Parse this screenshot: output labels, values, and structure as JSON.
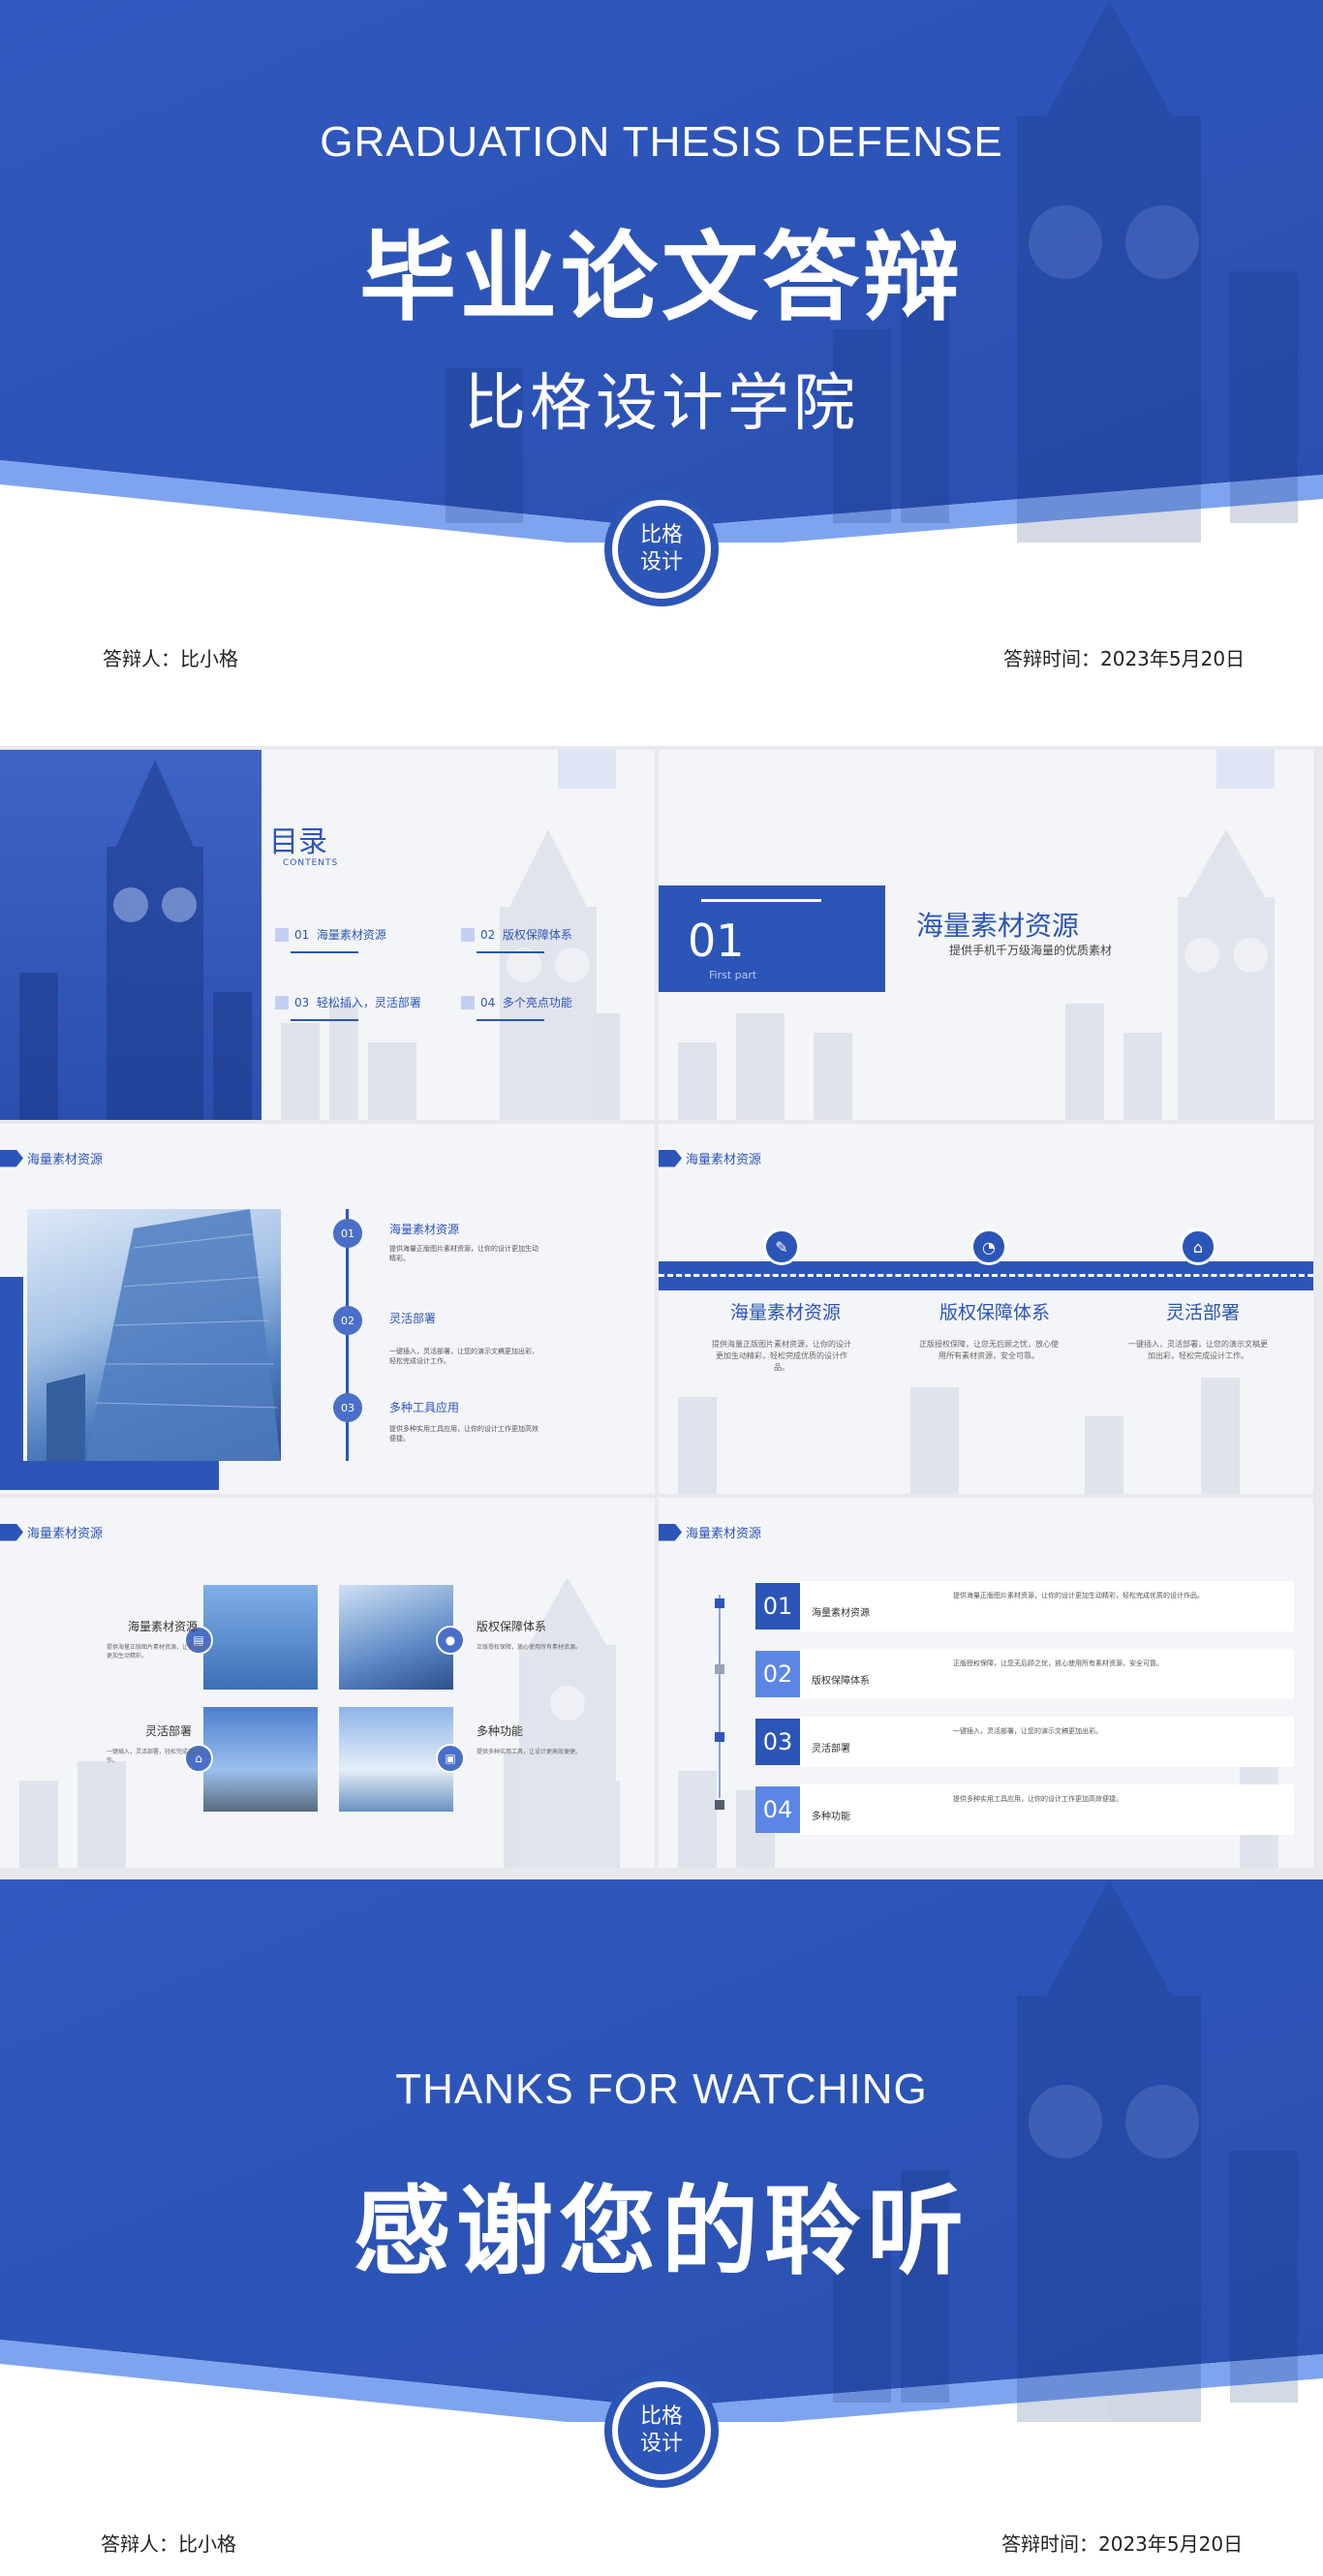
{
  "colors": {
    "brand_blue": "#2c55b8",
    "light_blue": "#4a6fc8",
    "sky_blue": "#7fa4ef",
    "page_bg": "#e7e9ee"
  },
  "cover": {
    "title_en": "GRADUATION THESIS DEFENSE",
    "title_cn": "毕业论文答辩",
    "school": "比格设计学院",
    "seal_line1": "比格",
    "seal_line2": "设计",
    "respondent": "答辩人：比小格",
    "date": "答辩时间：2023年5月20日"
  },
  "toc": {
    "title": "目录",
    "subtitle": "CONTENTS",
    "items": [
      {
        "num": "01",
        "label": "海量素材资源"
      },
      {
        "num": "02",
        "label": "版权保障体系"
      },
      {
        "num": "03",
        "label": "轻松插入，灵活部署"
      },
      {
        "num": "04",
        "label": "多个亮点功能"
      }
    ]
  },
  "chapter": {
    "num": "01",
    "part": "First part",
    "title": "海量素材资源",
    "subtitle": "提供手机千万级海量的优质素材"
  },
  "section_tag": "海量素材资源",
  "timeline_slide": {
    "points": [
      {
        "num": "01",
        "title": "海量素材资源",
        "text": "提供海量正版图片素材资源，让你的设计更加生动精彩。"
      },
      {
        "num": "02",
        "title": "灵活部署",
        "text": "一键插入，灵活部署，让您的演示文稿更加出彩，轻松完成设计工作。"
      },
      {
        "num": "03",
        "title": "多种工具应用",
        "text": "提供多种实用工具应用，让你的设计工作更加高效便捷。"
      }
    ]
  },
  "feature_slide": {
    "items": [
      {
        "icon": "✎",
        "title": "海量素材资源",
        "text": "提供海量正版图片素材资源，让你的设计更加生动精彩，轻松完成优质的设计作品。"
      },
      {
        "icon": "◔",
        "title": "版权保障体系",
        "text": "正版授权保障，让您无后顾之忧，放心使用所有素材资源，安全可靠。"
      },
      {
        "icon": "⌂",
        "title": "灵活部署",
        "text": "一键插入，灵活部署，让您的演示文稿更加出彩，轻松完成设计工作。"
      }
    ]
  },
  "grid_slide": {
    "items": [
      {
        "icon": "▤",
        "title": "海量素材资源",
        "text": "提供海量正版图片素材资源，让你的设计更加生动精彩。"
      },
      {
        "icon": "●",
        "title": "版权保障体系",
        "text": "正版授权保障，放心使用所有素材资源。"
      },
      {
        "icon": "⌂",
        "title": "灵活部署",
        "text": "一键插入，灵活部署，轻松完成设计工作。"
      },
      {
        "icon": "▣",
        "title": "多种功能",
        "text": "提供多种实用工具，让设计更高效便捷。"
      }
    ]
  },
  "list_slide": {
    "items": [
      {
        "num": "01",
        "label": "海量素材资源",
        "text": "提供海量正版图片素材资源，让你的设计更加生动精彩，轻松完成优质的设计作品。"
      },
      {
        "num": "02",
        "label": "版权保障体系",
        "text": "正版授权保障，让您无后顾之忧，放心使用所有素材资源，安全可靠。"
      },
      {
        "num": "03",
        "label": "灵活部署",
        "text": "一键插入，灵活部署，让您的演示文稿更加出彩。"
      },
      {
        "num": "04",
        "label": "多种功能",
        "text": "提供多种实用工具应用，让你的设计工作更加高效便捷。"
      }
    ]
  },
  "closing": {
    "title_en": "THANKS FOR WATCHING",
    "title_cn": "感谢您的聆听",
    "seal_line1": "比格",
    "seal_line2": "设计",
    "respondent": "答辩人：比小格",
    "date": "答辩时间：2023年5月20日"
  }
}
